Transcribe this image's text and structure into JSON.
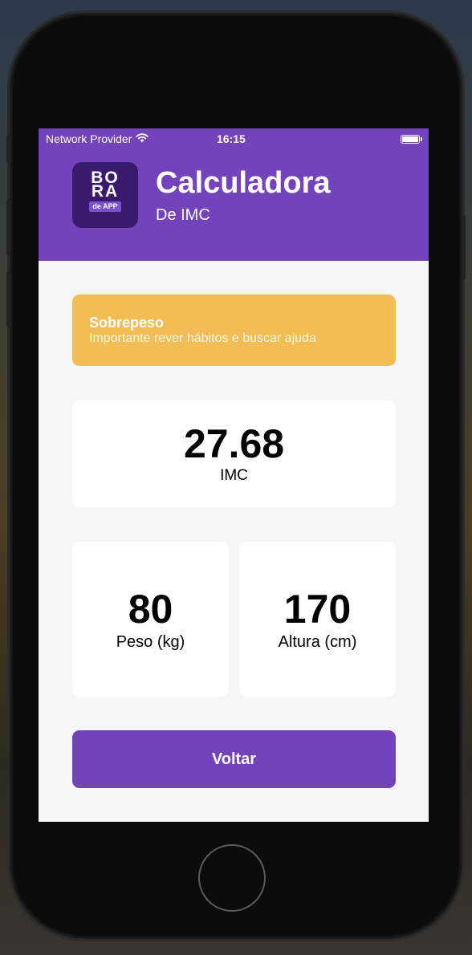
{
  "status_bar": {
    "carrier": "Network Provider",
    "time": "16:15"
  },
  "header": {
    "logo_line1": "BO",
    "logo_line2": "RA",
    "logo_tag": "de APP",
    "title": "Calculadora",
    "subtitle": "De IMC"
  },
  "result": {
    "category": "Sobrepeso",
    "advice": "Importante rever hábitos e buscar ajuda",
    "category_color": "#f2bd54"
  },
  "imc": {
    "value": "27.68",
    "label": "IMC"
  },
  "metrics": {
    "peso": {
      "value": "80",
      "label": "Peso (kg)"
    },
    "altura": {
      "value": "170",
      "label": "Altura (cm)"
    }
  },
  "actions": {
    "back_label": "Voltar"
  },
  "colors": {
    "primary": "#7343bb",
    "logo_bg": "#3a1a6c",
    "screen_bg": "#f6f6f6"
  },
  "icons": {
    "wifi": "wifi-icon",
    "battery": "battery-icon"
  }
}
